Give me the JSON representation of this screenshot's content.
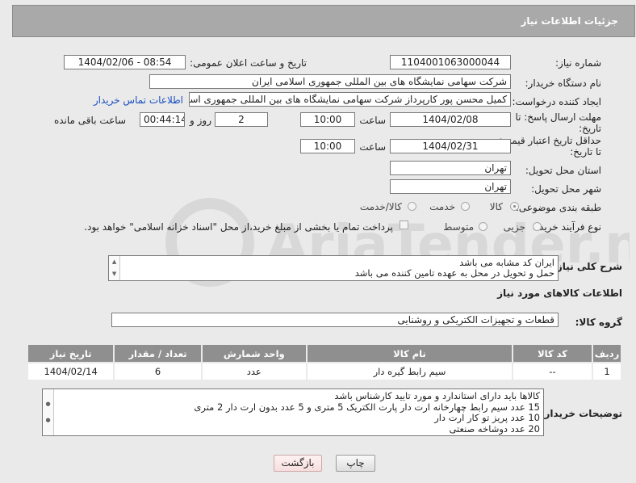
{
  "header": {
    "title": "جزئیات اطلاعات نیاز"
  },
  "fields": {
    "need_number_label": "شماره نیاز:",
    "need_number": "1104001063000044",
    "announce_label": "تاریخ و ساعت اعلان عمومی:",
    "announce_value": "1404/02/06 - 08:54",
    "buyer_org_label": "نام دستگاه خریدار:",
    "buyer_org": "شرکت سهامی نمایشگاه های بین المللی جمهوری اسلامی ایران",
    "creator_label": "ایجاد کننده درخواست:",
    "creator": "کمیل محسن پور کارپرداز شرکت سهامی نمایشگاه های بین المللی جمهوری اسلامی ایران",
    "contact_link": "اطلاعات تماس خریدار",
    "reply_deadline_label": "مهلت ارسال پاسخ: تا تاریخ:",
    "reply_date": "1404/02/08",
    "time_label": "ساعت",
    "reply_time": "10:00",
    "days_value": "2",
    "days_label": "روز و",
    "remaining_time": "00:44:14",
    "remaining_label": "ساعت باقی مانده",
    "price_validity_label": "حداقل تاریخ اعتبار قیمت: تا تاریخ:",
    "price_date": "1404/02/31",
    "price_time": "10:00",
    "province_label": "استان محل تحویل:",
    "province": "تهران",
    "city_label": "شهر محل تحویل:",
    "city": "تهران",
    "category_label": "طبقه بندی موضوعی:",
    "category_options": [
      "کالا",
      "خدمت",
      "کالا/خدمت"
    ],
    "process_label": "نوع فرآیند خرید :",
    "process_options": [
      "جزیی",
      "متوسط"
    ],
    "payment_note": "پرداخت تمام یا بخشی از مبلغ خرید،از محل \"اسناد خزانه اسلامی\" خواهد بود."
  },
  "description": {
    "label": "شرح کلی نیاز:",
    "lines": [
      "ایران کد مشابه می باشد",
      "حمل و تحویل در محل به عهده تامین کننده می باشد"
    ]
  },
  "goods": {
    "section_title": "اطلاعات کالاهای مورد نیاز",
    "group_label": "گروه کالا:",
    "group_value": "قطعات و تجهیزات الکتریکی و روشنایی",
    "columns": [
      "ردیف",
      "کد کالا",
      "نام کالا",
      "واحد شمارش",
      "تعداد / مقدار",
      "تاریخ نیاز"
    ],
    "rows": [
      [
        "1",
        "--",
        "سیم رابط گیره دار",
        "عدد",
        "6",
        "1404/02/14"
      ]
    ]
  },
  "buyer_notes": {
    "label": "توضیحات خریدار:",
    "lines": [
      "کالاها باید دارای استاندارد و مورد تایید کارشناس باشد",
      "15 عدد سیم رابط چهارخانه ارت دار پارت الکتریک 5 متری و 5 عدد بدون ارت دار 2 متری",
      "10 عدد پریز تو کار ارت دار",
      "20 عدد دوشاخه صنعتی"
    ]
  },
  "buttons": {
    "print": "چاپ",
    "back": "بازگشت"
  },
  "watermark": "AriaTender.neT",
  "colors": {
    "header_bg": "#a9a9a9",
    "table_header_bg": "#8f8f8f",
    "link": "#1a4fbf"
  }
}
